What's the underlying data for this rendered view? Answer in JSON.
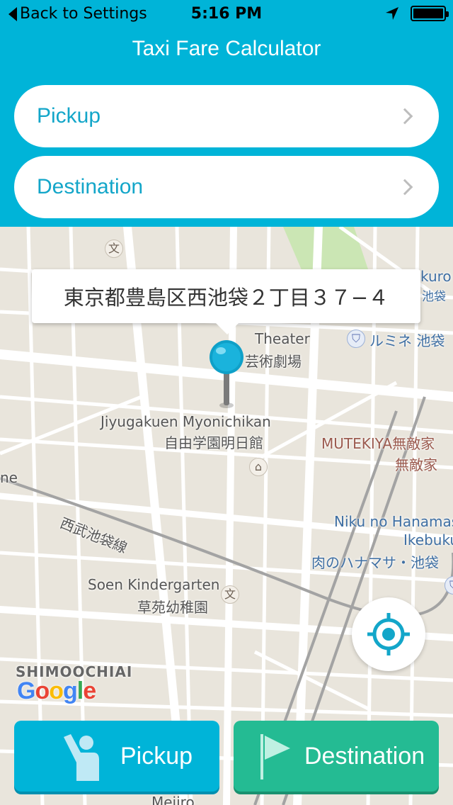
{
  "status_bar": {
    "back_label": "Back to Settings",
    "time": "5:16 PM",
    "icons": [
      "location-arrow-icon",
      "battery-icon"
    ]
  },
  "header": {
    "title": "Taxi Fare Calculator",
    "pickup_label": "Pickup",
    "destination_label": "Destination"
  },
  "map": {
    "callout_address": "東京都豊島区西池袋２丁目３７−４",
    "labels": {
      "theater_en": "Theater",
      "theater_jp": "芸術劇場",
      "jiyugakuen_en": "Jiyugakuen Myonichikan",
      "jiyugakuen_jp": "自由学園明日館",
      "mutekiya_1": "MUTEKIYA無敵家",
      "mutekiya_2": "無敵家",
      "niku_1": "Niku no Hanamas",
      "niku_2": "Ikebuku",
      "niku_3": "肉のハナマサ・池袋",
      "lumine": "ルミネ 池袋",
      "kuro": "kuro",
      "ikebukuro_jp": "池袋",
      "seibu_line": "西武池袋線",
      "soen_en": "Soen Kindergarten",
      "soen_jp": "草苑幼稚園",
      "shimoochiai": "SHIMOOCHIAI",
      "edge_ne": "ne",
      "mejiro": "Mejiro"
    },
    "poi_glyph": "文",
    "google_letters": [
      "G",
      "o",
      "o",
      "g",
      "l",
      "e"
    ],
    "colors": {
      "road": "#ffffff",
      "land": "#e9e5dc",
      "park": "#cbe6b4",
      "rail": "#9a9a9a"
    }
  },
  "buttons": {
    "pickup": "Pickup",
    "destination": "Destination"
  },
  "colors": {
    "accent": "#00b4d8",
    "destination_green": "#24bb93",
    "field_text": "#13a6c9"
  }
}
